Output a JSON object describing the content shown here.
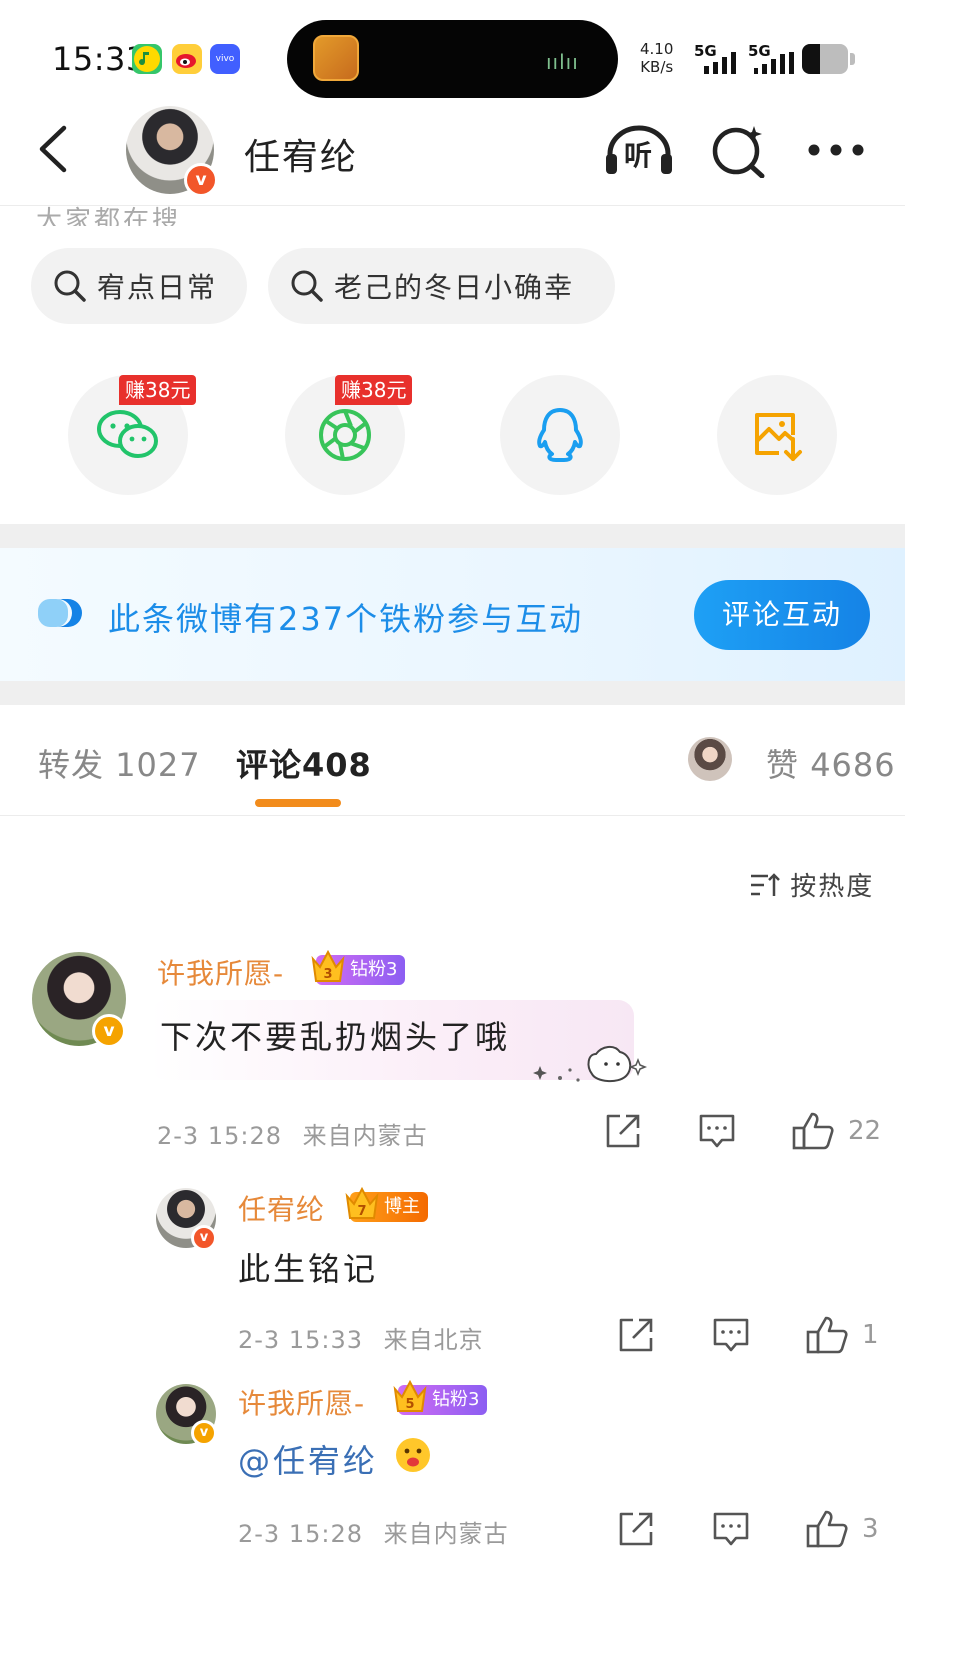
{
  "status_bar": {
    "time": "15:33",
    "network_speed_value": "4.10",
    "network_speed_unit": "KB/s",
    "signal_1": "5G",
    "signal_2": "5G",
    "app_icons": [
      "qq-music-icon",
      "weibo-icon",
      "vivo-icon"
    ],
    "battery_level": 0.4
  },
  "header": {
    "title": "任宥纶",
    "back_icon": "chevron-left-icon",
    "listen_label": "听",
    "search_icon": "search-sparkle-icon",
    "more_icon": "more-dots-icon"
  },
  "faded_text": "大家都在搜",
  "search_chips": [
    {
      "label": "宥点日常"
    },
    {
      "label": "老己的冬日小确幸"
    }
  ],
  "share": {
    "items": [
      "wechat-icon",
      "moments-icon",
      "qq-icon",
      "save-image-icon"
    ],
    "reward_label": "赚38元"
  },
  "fan_banner": {
    "text": "此条微博有237个铁粉参与互动",
    "button": "评论互动"
  },
  "tabs": {
    "repost_label": "转发",
    "repost_count": "1027",
    "comment_label": "评论",
    "comment_count": "408",
    "like_label": "赞",
    "like_count": "4686"
  },
  "sort_label": "按热度",
  "comments": [
    {
      "name": "许我所愿-",
      "badge": "钻粉3",
      "badge_level": "3",
      "text": "下次不要乱扔烟头了哦",
      "time": "2-3 15:28",
      "location": "来自内蒙古",
      "likes": "22"
    },
    {
      "name": "任宥纶",
      "badge": "博主",
      "badge_level": "7",
      "text": "此生铭记",
      "time": "2-3 15:33",
      "location": "来自北京",
      "likes": "1"
    },
    {
      "name": "许我所愿-",
      "badge": "钻粉3",
      "badge_level": "5",
      "text": "@任宥纶",
      "time": "2-3 15:28",
      "location": "来自内蒙古",
      "likes": "3"
    }
  ],
  "colors": {
    "accent_orange": "#f28c1c",
    "link_blue": "#1c8de8",
    "username_orange": "#e6893a",
    "fan_badge_purple": "#a865f2",
    "blogger_badge_orange": "#ff8a0d"
  }
}
